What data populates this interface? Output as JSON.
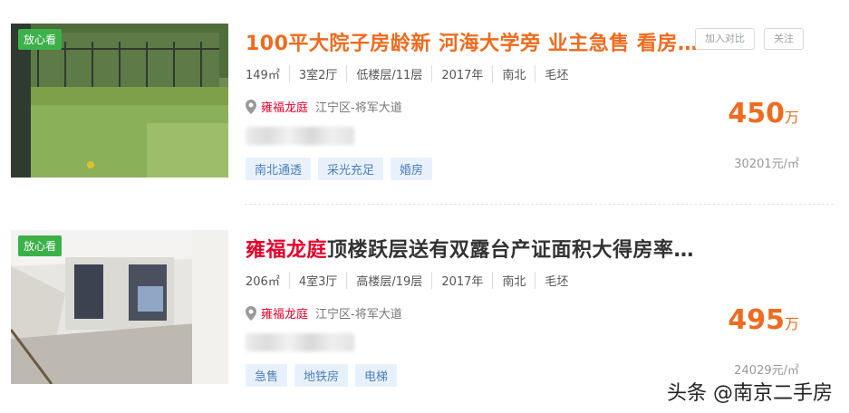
{
  "listings": [
    {
      "badge": "放心看",
      "title": "100平大院子房龄新 河海大学旁 业主急售 看房方…",
      "actions": {
        "compare": "加入对比",
        "follow": "关注"
      },
      "specs": [
        "149㎡",
        "3室2厅",
        "低楼层/11层",
        "2017年",
        "南北",
        "毛坯"
      ],
      "community": "雍福龙庭",
      "district": "江宁区-将军大道",
      "tags": [
        "南北通透",
        "采光充足",
        "婚房"
      ],
      "price": "450",
      "price_unit": "万",
      "unit_price": "30201元/㎡"
    },
    {
      "badge": "放心看",
      "title_highlight": "雍福龙庭",
      "title_rest": "顶楼跃层送有双露台产证面积大得房率高…",
      "specs": [
        "206㎡",
        "4室3厅",
        "高楼层/19层",
        "2017年",
        "南北",
        "毛坯"
      ],
      "community": "雍福龙庭",
      "district": "江宁区-将军大道",
      "tags": [
        "急售",
        "地铁房",
        "电梯"
      ],
      "price": "495",
      "price_unit": "万",
      "unit_price": "24029元/㎡"
    }
  ],
  "watermark": "头条 @南京二手房",
  "colors": {
    "accent": "#ee6b1f",
    "highlight": "#e4002b",
    "badge": "#3cb14a",
    "tag_bg": "#e8f1fb",
    "tag_text": "#4d7eb8"
  }
}
